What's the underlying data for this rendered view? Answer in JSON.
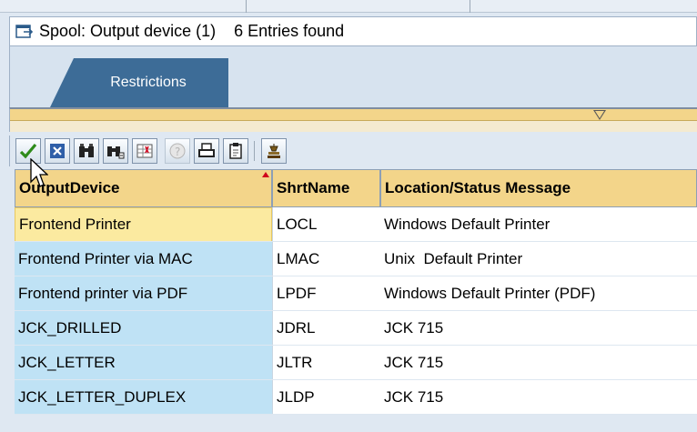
{
  "window": {
    "title": "Spool: Output device (1)",
    "entries_found": "6 Entries found"
  },
  "tabs": [
    {
      "label": "Restrictions",
      "active": true
    }
  ],
  "toolbar": {
    "buttons": [
      {
        "name": "accept-icon",
        "enabled": true
      },
      {
        "name": "cancel-icon",
        "enabled": true
      },
      {
        "name": "find-icon",
        "enabled": true
      },
      {
        "name": "find-next-icon",
        "enabled": true
      },
      {
        "name": "select-icon",
        "enabled": true
      },
      {
        "name": "help-icon",
        "enabled": false
      },
      {
        "name": "print-icon",
        "enabled": true
      },
      {
        "name": "copy-icon",
        "enabled": true
      },
      {
        "name": "personal-list-icon",
        "enabled": true
      }
    ]
  },
  "table": {
    "columns": [
      "OutputDevice",
      "ShrtName",
      "Location/Status Message"
    ],
    "sorted_column": "OutputDevice",
    "rows": [
      {
        "device": "Frontend Printer",
        "short": "LOCL",
        "location": "Windows Default Printer",
        "selected": true
      },
      {
        "device": "Frontend Printer via MAC",
        "short": "LMAC",
        "location": "Unix  Default Printer",
        "selected": false
      },
      {
        "device": "Frontend printer via PDF",
        "short": "LPDF",
        "location": "Windows Default Printer (PDF)",
        "selected": false
      },
      {
        "device": "JCK_DRILLED",
        "short": "JDRL",
        "location": "JCK 715",
        "selected": false
      },
      {
        "device": "JCK_LETTER",
        "short": "JLTR",
        "location": "JCK 715",
        "selected": false
      },
      {
        "device": "JCK_LETTER_DUPLEX",
        "short": "JLDP",
        "location": "JCK 715",
        "selected": false
      }
    ]
  },
  "colors": {
    "header_bg": "#f3d58a",
    "tab_bg": "#3d6c97",
    "key_column_bg": "#bfe2f5",
    "selected_cell_bg": "#fbeaa0"
  }
}
